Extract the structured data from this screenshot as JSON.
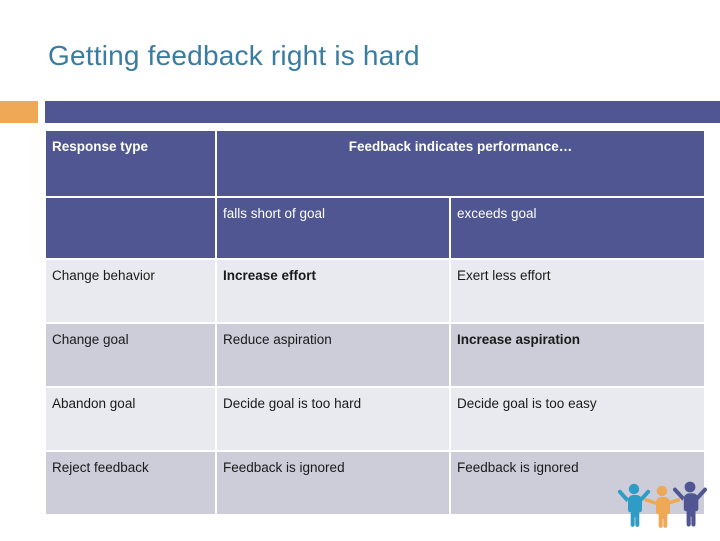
{
  "slide": {
    "title": "Getting feedback right is hard"
  },
  "colors": {
    "title": "#3A7CA0",
    "accent_orange": "#EFA855",
    "accent_blue": "#4F5691",
    "header_blue": "#4F5691",
    "row_light": "#E9EAEF",
    "row_dark": "#CCCDD9",
    "figure_teal": "#2E9CC4",
    "figure_orange": "#EFA855",
    "figure_navy": "#4F5691"
  },
  "table": {
    "header": {
      "response_type": "Response type",
      "span_label": "Feedback indicates performance…",
      "sub_falls_short": "falls short of goal",
      "sub_exceeds": "exceeds goal"
    },
    "rows": [
      {
        "response": "Change behavior",
        "falls_short": "Increase effort",
        "falls_short_bold": true,
        "exceeds": "Exert less effort",
        "exceeds_bold": false
      },
      {
        "response": "Change goal",
        "falls_short": "Reduce aspiration",
        "falls_short_bold": false,
        "exceeds": "Increase aspiration",
        "exceeds_bold": true
      },
      {
        "response": "Abandon goal",
        "falls_short": "Decide goal is too hard",
        "falls_short_bold": false,
        "exceeds": "Decide goal is too easy",
        "exceeds_bold": false
      },
      {
        "response": "Reject feedback",
        "falls_short": "Feedback is ignored",
        "falls_short_bold": false,
        "exceeds": "Feedback is ignored",
        "exceeds_bold": false
      }
    ]
  },
  "decoration": {
    "figures_label": "three-people-celebrating"
  }
}
